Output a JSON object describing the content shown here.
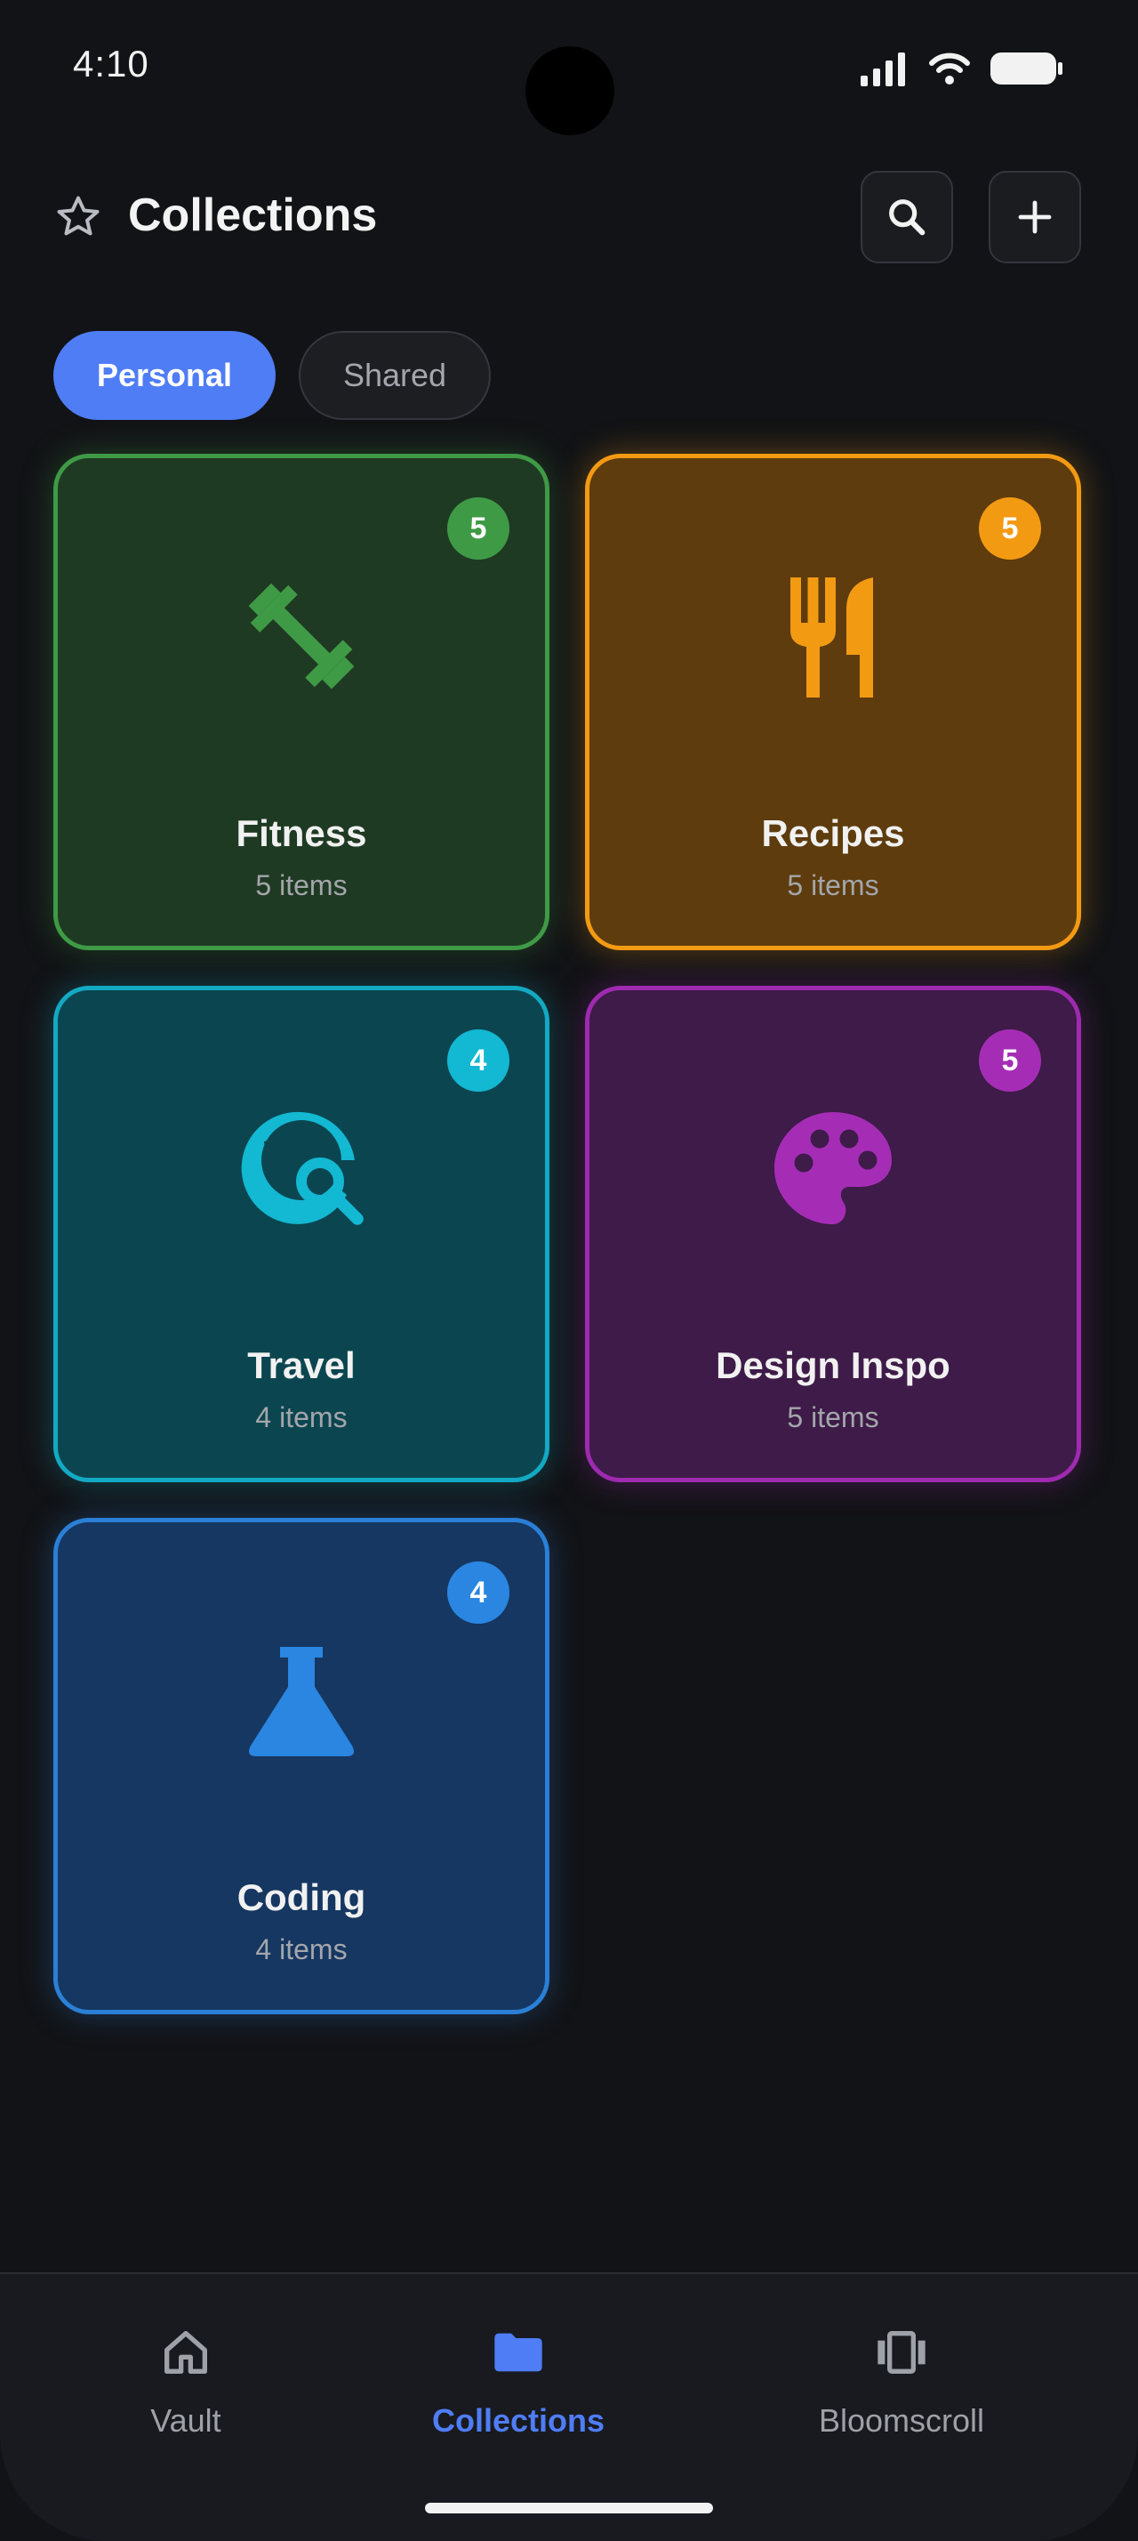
{
  "status_bar": {
    "time": "4:10"
  },
  "header": {
    "title": "Collections",
    "star_icon": "star-outline-icon",
    "search_icon": "search-icon",
    "add_icon": "plus-icon"
  },
  "tabs": [
    {
      "label": "Personal",
      "active": true
    },
    {
      "label": "Shared",
      "active": false
    }
  ],
  "collections": [
    {
      "name": "Fitness",
      "count_label": "5 items",
      "badge": "5",
      "icon": "dumbbell-icon",
      "color": "#3f9a45"
    },
    {
      "name": "Recipes",
      "count_label": "5 items",
      "badge": "5",
      "icon": "fork-knife-icon",
      "color": "#f39a13"
    },
    {
      "name": "Travel",
      "count_label": "4 items",
      "badge": "4",
      "icon": "globe-search-icon",
      "color": "#13b8d3"
    },
    {
      "name": "Design Inspo",
      "count_label": "5 items",
      "badge": "5",
      "icon": "palette-icon",
      "color": "#a52db6"
    },
    {
      "name": "Coding",
      "count_label": "4 items",
      "badge": "4",
      "icon": "flask-icon",
      "color": "#2a86e0"
    }
  ],
  "bottom_nav": [
    {
      "label": "Vault",
      "icon": "home-icon",
      "active": false
    },
    {
      "label": "Collections",
      "icon": "folder-icon",
      "active": true
    },
    {
      "label": "Bloomscroll",
      "icon": "carousel-icon",
      "active": false
    }
  ],
  "colors": {
    "accent": "#4f7df5",
    "background": "#121316"
  }
}
